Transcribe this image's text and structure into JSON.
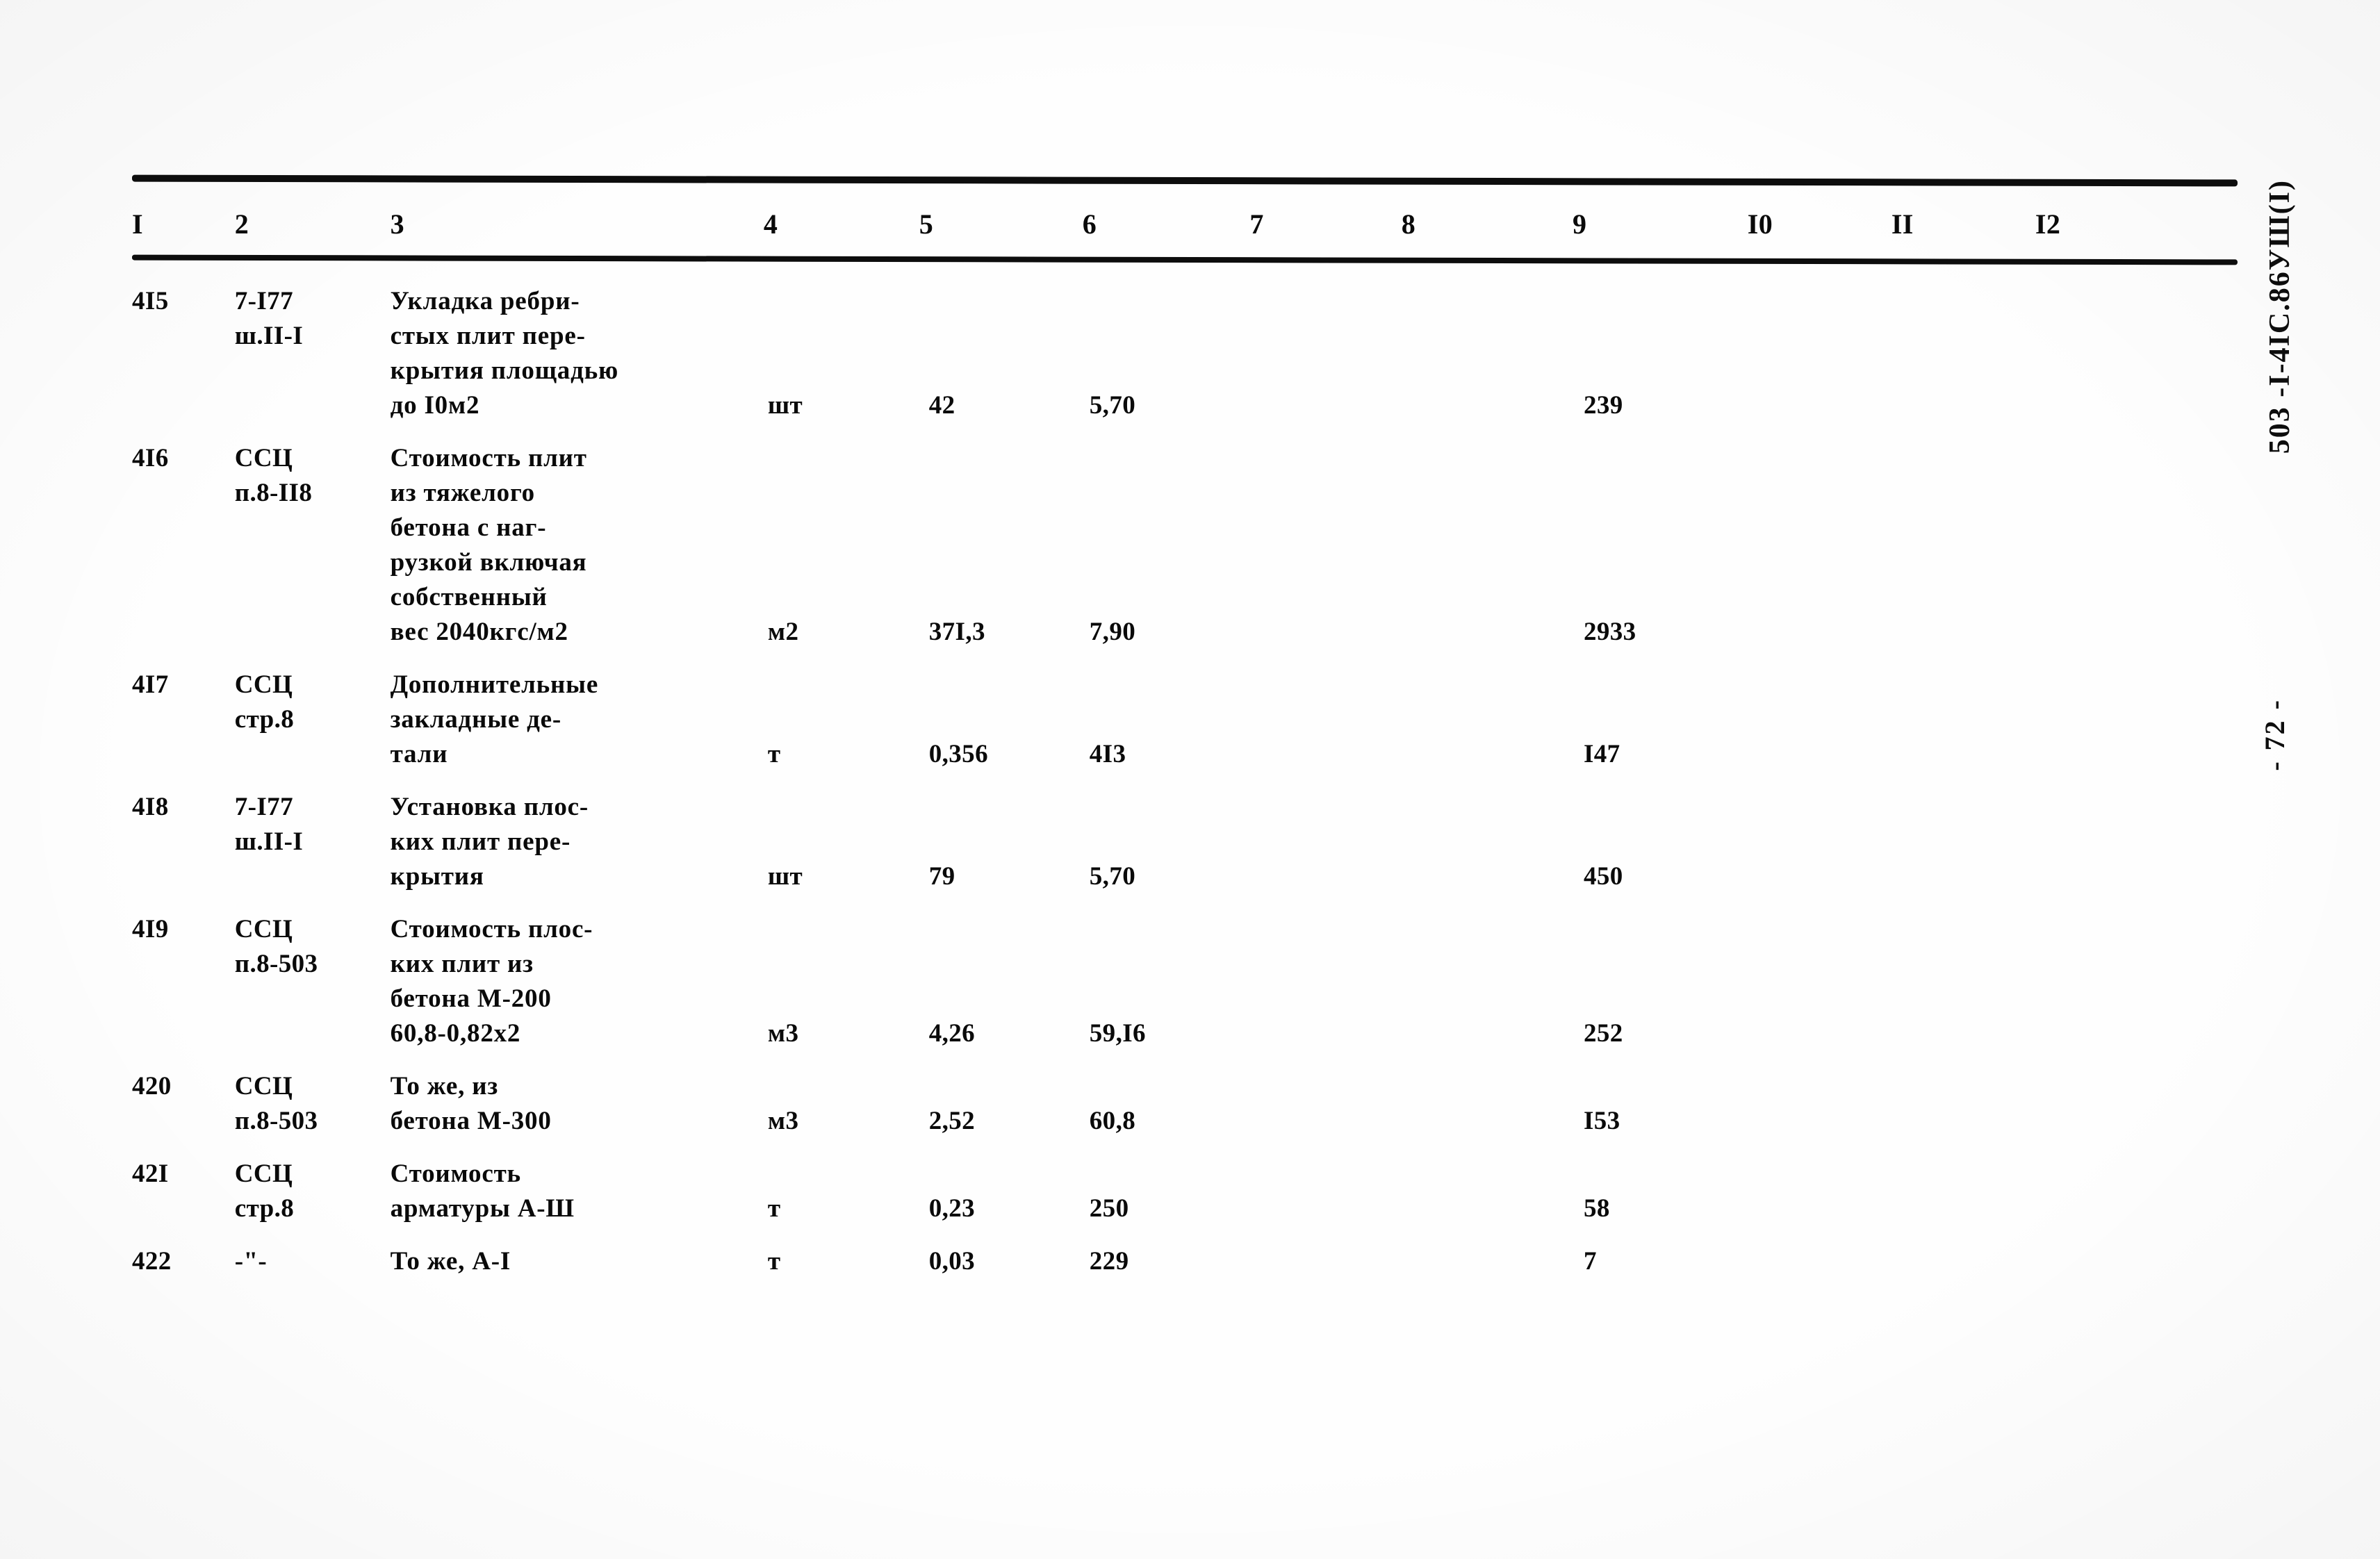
{
  "document": {
    "sheet_code": "503 -I-4IC.86УШ(I)",
    "page_number": "- 72 -"
  },
  "table": {
    "column_headers": [
      "I",
      "2",
      "3",
      "4",
      "5",
      "6",
      "7",
      "8",
      "9",
      "I0",
      "II",
      "I2"
    ],
    "rows": [
      {
        "num": "4I5",
        "code": "7-I77\nш.II-I",
        "description": "Укладка ребри-\nстых плит пере-\nкрытия площадью\nдо I0м2",
        "unit": "шт",
        "quantity": "42",
        "price": "5,70",
        "c7": "",
        "c8": "",
        "total": "239",
        "c10": "",
        "c11": "",
        "c12": ""
      },
      {
        "num": "4I6",
        "code": "ССЦ\nп.8-II8",
        "description": "Стоимость плит\nиз тяжелого\nбетона с наг-\nрузкой включая\nсобственный\nвес 2040кгс/м2",
        "unit": "м2",
        "quantity": "37I,3",
        "price": "7,90",
        "c7": "",
        "c8": "",
        "total": "2933",
        "c10": "",
        "c11": "",
        "c12": ""
      },
      {
        "num": "4I7",
        "code": "ССЦ\nстр.8",
        "description": "Дополнительные\nзакладные де-\nтали",
        "unit": "т",
        "quantity": "0,356",
        "price": "4I3",
        "c7": "",
        "c8": "",
        "total": "I47",
        "c10": "",
        "c11": "",
        "c12": ""
      },
      {
        "num": "4I8",
        "code": "7-I77\nш.II-I",
        "description": "Установка плос-\nких плит пере-\nкрытия",
        "unit": "шт",
        "quantity": "79",
        "price": "5,70",
        "c7": "",
        "c8": "",
        "total": "450",
        "c10": "",
        "c11": "",
        "c12": ""
      },
      {
        "num": "4I9",
        "code": "ССЦ\nп.8-503",
        "description": "Стоимость плос-\nких плит из\nбетона М-200\n60,8-0,82х2",
        "unit": "м3",
        "quantity": "4,26",
        "price": "59,I6",
        "c7": "",
        "c8": "",
        "total": "252",
        "c10": "",
        "c11": "",
        "c12": ""
      },
      {
        "num": "420",
        "code": "ССЦ\nп.8-503",
        "description": "То же, из\nбетона М-300",
        "unit": "м3",
        "quantity": "2,52",
        "price": "60,8",
        "c7": "",
        "c8": "",
        "total": "I53",
        "c10": "",
        "c11": "",
        "c12": ""
      },
      {
        "num": "42I",
        "code": "ССЦ\nстр.8",
        "description": "Стоимость\nарматуры А-Ш",
        "unit": "т",
        "quantity": "0,23",
        "price": "250",
        "c7": "",
        "c8": "",
        "total": "58",
        "c10": "",
        "c11": "",
        "c12": ""
      },
      {
        "num": "422",
        "code": "-\"-",
        "description": "То же, А-I",
        "unit": "т",
        "quantity": "0,03",
        "price": "229",
        "c7": "",
        "c8": "",
        "total": "7",
        "c10": "",
        "c11": "",
        "c12": ""
      }
    ]
  }
}
